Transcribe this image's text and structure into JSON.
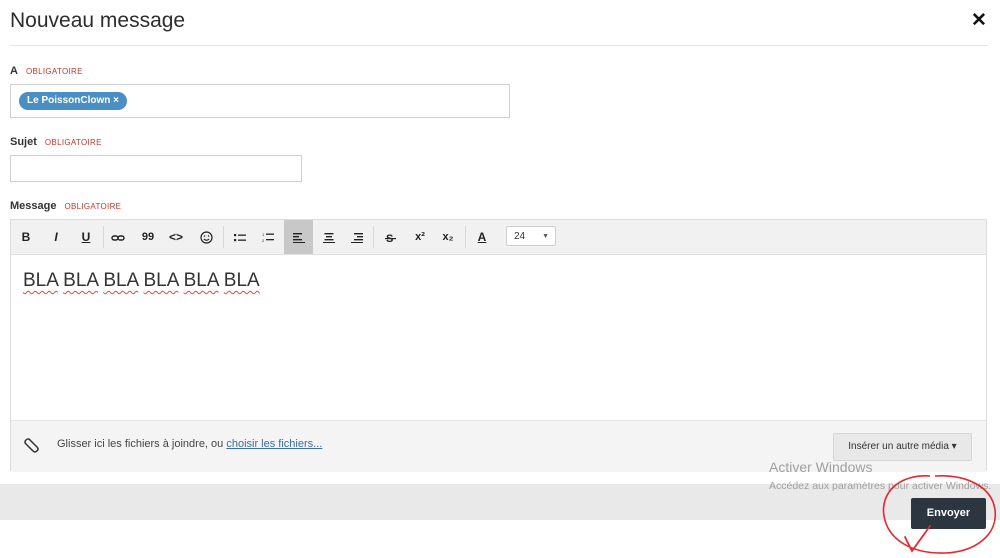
{
  "dialog": {
    "title": "Nouveau message",
    "close_symbol": "✕"
  },
  "recipient": {
    "label": "A",
    "required": "OBLIGATOIRE",
    "tokens": [
      "Le PoissonClown ×"
    ]
  },
  "subject": {
    "label": "Sujet",
    "required": "OBLIGATOIRE",
    "value": ""
  },
  "message": {
    "label": "Message",
    "required": "OBLIGATOIRE",
    "toolbar": {
      "bold": "B",
      "italic": "I",
      "underline": "U",
      "quote": "99",
      "code": "<>",
      "superscript": "x²",
      "subscript": "x₂",
      "font_color": "A",
      "font_size": "24"
    },
    "body_words": [
      "BLA",
      "BLA",
      "BLA",
      "BLA",
      "BLA",
      "BLA"
    ]
  },
  "attachments": {
    "text": "Glisser ici les fichiers à joindre, ou ",
    "link": "choisir les fichiers...",
    "media_button": "Insérer un autre média ▾"
  },
  "actions": {
    "send": "Envoyer"
  },
  "watermark": {
    "line1": "Activer Windows",
    "line2": "Accédez aux paramètres pour activer Windows."
  },
  "colors": {
    "required": "#c0392b",
    "token_bg": "#4a8fc3",
    "send_bg": "#2b3640",
    "annotation": "#e8262b"
  }
}
